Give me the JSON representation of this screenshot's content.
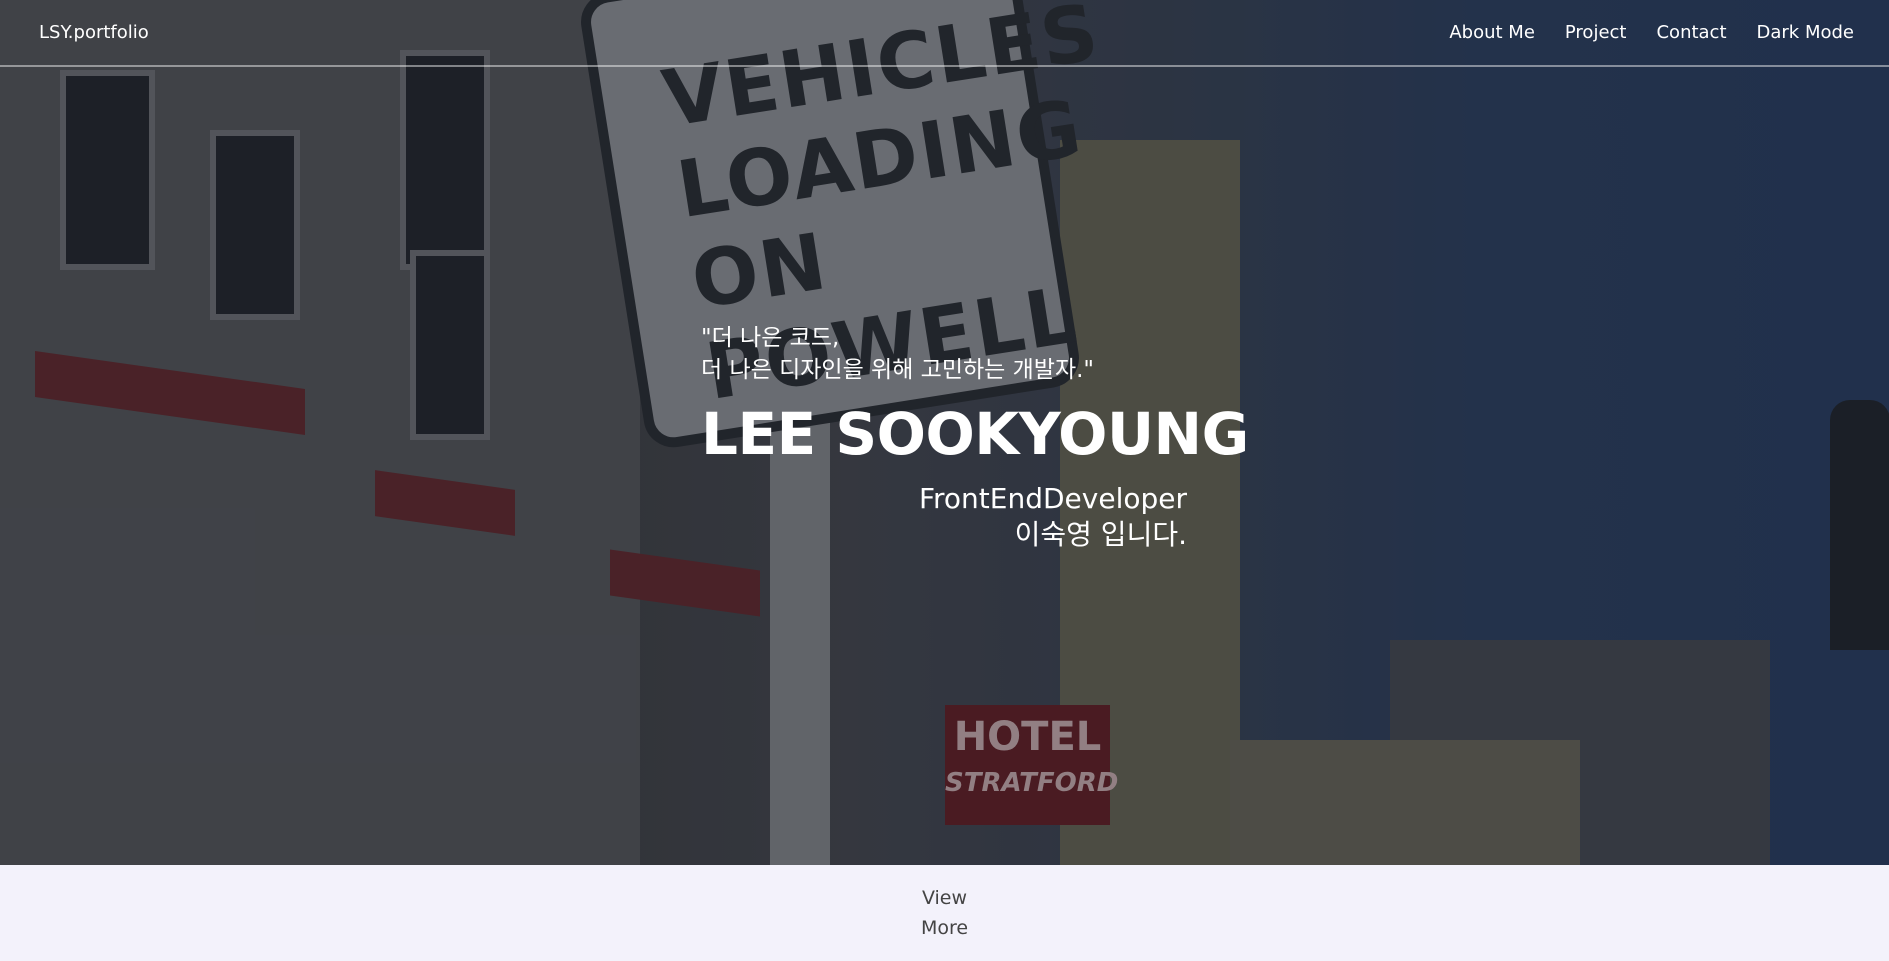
{
  "nav": {
    "logo": "LSY.portfolio",
    "items": [
      {
        "label": "About Me"
      },
      {
        "label": "Project"
      },
      {
        "label": "Contact"
      },
      {
        "label": "Dark Mode"
      }
    ]
  },
  "hero": {
    "quote_line1": "\"더 나은 코드,",
    "quote_line2": "더 나은 디자인을 위해 고민하는 개발자.\"",
    "name": "LEE SOOKYOUNG",
    "role_line1": "FrontEndDeveloper",
    "role_line2": "이숙영 입니다.",
    "background": {
      "sign_lines": [
        "VEHICLES",
        "LOADING",
        "ON POWELL"
      ],
      "hotel_sign_lines": [
        "HOTEL",
        "STRATFORD"
      ]
    }
  },
  "view_more": {
    "line1": "View",
    "line2": "More"
  },
  "colors": {
    "text_on_hero": "#ffffff",
    "bottom_bar": "#f3f2fb",
    "button_text": "#444444"
  }
}
